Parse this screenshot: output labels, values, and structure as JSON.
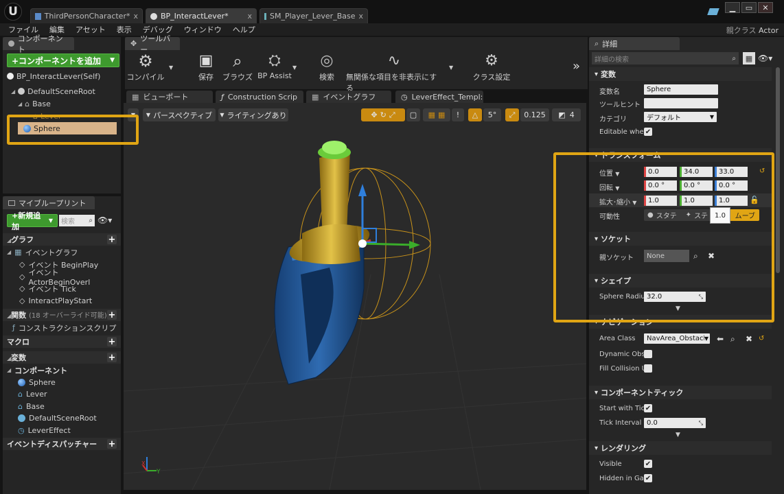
{
  "titlebar": {
    "tabs": [
      "ThirdPersonCharacter*",
      "BP_InteractLever*",
      "SM_Player_Lever_Base"
    ],
    "close": "x"
  },
  "menu": [
    "ファイル",
    "編集",
    "アセット",
    "表示",
    "デバッグ",
    "ウィンドウ",
    "ヘルプ"
  ],
  "parent_class": {
    "label": "親クラス",
    "value": "Actor"
  },
  "components_panel": {
    "tab": "コンポーネント",
    "add_button": "+コンポーネントを追加",
    "self": "BP_InteractLever(Self)",
    "tree": [
      "DefaultSceneRoot",
      "Base",
      "Lever",
      "Sphere"
    ]
  },
  "blueprint_panel": {
    "tab": "マイブループリント",
    "new_button": "+新規追加",
    "search_placeholder": "検索",
    "graph_head": "グラフ",
    "event_graph": "イベントグラフ",
    "events": [
      "イベント BeginPlay",
      "イベント ActorBeginOverl",
      "イベント Tick",
      "InteractPlayStart"
    ],
    "functions_head": "関数",
    "functions_note": "(18 オーバーライド可能)",
    "construction": "コンストラクションスクリプ",
    "macros": "マクロ",
    "variables": "変数",
    "components_head": "コンポーネント",
    "components": [
      "Sphere",
      "Lever",
      "Base",
      "DefaultSceneRoot",
      "LeverEffect"
    ],
    "dispatchers": "イベントディスパッチャー"
  },
  "toolbar": {
    "tab": "ツールバー",
    "buttons": [
      "コンパイル",
      "保存",
      "ブラウズ",
      "BP Assist",
      "検索",
      "無関係な項目を非表示にする",
      "クラス設定"
    ],
    "more": "»"
  },
  "viewport": {
    "tabs": [
      "ビューポート",
      "Construction Scrip",
      "イベントグラフ",
      "LeverEffect_Templ:"
    ],
    "perspective": "パースペクティブ",
    "lighting": "ライティングあり",
    "snap_rot": "5°",
    "snap_scale": "0.125",
    "cam_speed": "4",
    "axis_x": "X",
    "axis_y": "Y"
  },
  "details": {
    "tab": "詳細",
    "search_placeholder": "詳細の検索",
    "sec_vars": "変数",
    "var_name_lbl": "変数名",
    "var_name": "Sphere",
    "tooltip_lbl": "ツールヒント",
    "category_lbl": "カテゴリ",
    "category": "デフォルト",
    "editable_lbl": "Editable when",
    "sec_transform": "トランスフォーム",
    "pos_lbl": "位置",
    "rot_lbl": "回転",
    "scale_lbl": "拡大･縮小",
    "pos": [
      "0.0",
      "34.0",
      "33.0"
    ],
    "rot": [
      "0.0 °",
      "0.0 °",
      "0.0 °"
    ],
    "scale": [
      "1.0",
      "1.0",
      "1.0"
    ],
    "mobility_lbl": "可動性",
    "mobility": [
      "スタテ",
      "ステ",
      "ムーブ"
    ],
    "tooltip_popup": "1.0",
    "sec_socket": "ソケット",
    "parent_socket_lbl": "親ソケット",
    "parent_socket": "None",
    "sec_shape": "シェイプ",
    "radius_lbl": "Sphere Radius",
    "radius": "32.0",
    "sec_nav": "ナビゲーション",
    "area_class_lbl": "Area Class",
    "area_class": "NavArea_Obstacle",
    "dyn_obst_lbl": "Dynamic Obst",
    "fill_coll_lbl": "Fill Collision U",
    "sec_tick": "コンポーネントティック",
    "start_tick_lbl": "Start with Tick",
    "tick_interval_lbl": "Tick Interval (",
    "tick_interval": "0.0",
    "sec_render": "レンダリング",
    "visible_lbl": "Visible",
    "hidden_lbl": "Hidden in Gam"
  },
  "colors": {
    "accent": "#e0a514",
    "green": "#3e9a2e",
    "selected": "#d9b48a"
  }
}
